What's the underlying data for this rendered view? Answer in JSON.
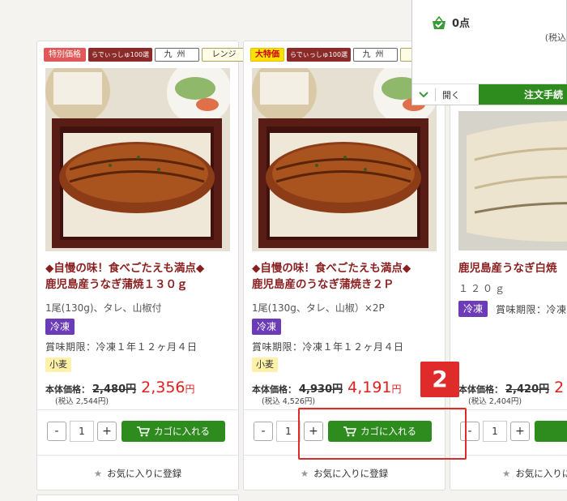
{
  "products": [
    {
      "badges": [
        "特別価格",
        "らでぃっしゅ100選",
        "九州",
        "レンジ"
      ],
      "title_line1": "◆自慢の味！食べごたえも満点◆",
      "title_line2": "鹿児島産うなぎ蒲焼１３０ｇ",
      "subtitle": "1尾(130g)、タレ、山椒付",
      "storage": "冷凍",
      "expiry": "賞味期限：冷凍１年１２ヶ月４日",
      "allergen": "小麦",
      "price_label": "本体価格：",
      "price_old": "2,480円",
      "price_new": "2,356",
      "price_unit": "円",
      "price_tax": "(税込 2,544円)",
      "qty": "1",
      "cart_label": "カゴに入れる",
      "favorite_label": "お気に入りに登録"
    },
    {
      "badges": [
        "大特価",
        "らでぃっしゅ100選",
        "九州",
        "レ"
      ],
      "title_line1": "◆自慢の味！食べごたえも満点◆",
      "title_line2": "鹿児島産のうなぎ蒲焼き２Ｐ",
      "subtitle": "1尾(130g、タレ、山椒）×2P",
      "storage": "冷凍",
      "expiry": "賞味期限：冷凍１年１２ヶ月４日",
      "allergen": "小麦",
      "price_label": "本体価格：",
      "price_old": "4,930円",
      "price_new": "4,191",
      "price_unit": "円",
      "price_tax": "(税込 4,526円)",
      "qty": "1",
      "cart_label": "カゴに入れる",
      "favorite_label": "お気に入りに登録"
    },
    {
      "title_line1": "鹿児島産うなぎ白焼",
      "subtitle": "１２０ｇ",
      "storage": "冷凍",
      "expiry": "賞味期限：冷凍",
      "price_label": "本体価格：",
      "price_old": "2,420円",
      "price_new": "2",
      "price_tax": "(税込 2,404円)",
      "qty": "1",
      "favorite_label": "お気に入りに登録"
    }
  ],
  "cart_panel": {
    "count": "0点",
    "tax_note": "(税込",
    "open_label": "開く",
    "checkout_label": "注文手続"
  },
  "annotation": {
    "number": "2"
  },
  "colors": {
    "accent_green": "#2e8b1e",
    "title_red": "#8a1f1f",
    "price_red": "#e02020",
    "frozen_purple": "#6b3bb8"
  }
}
